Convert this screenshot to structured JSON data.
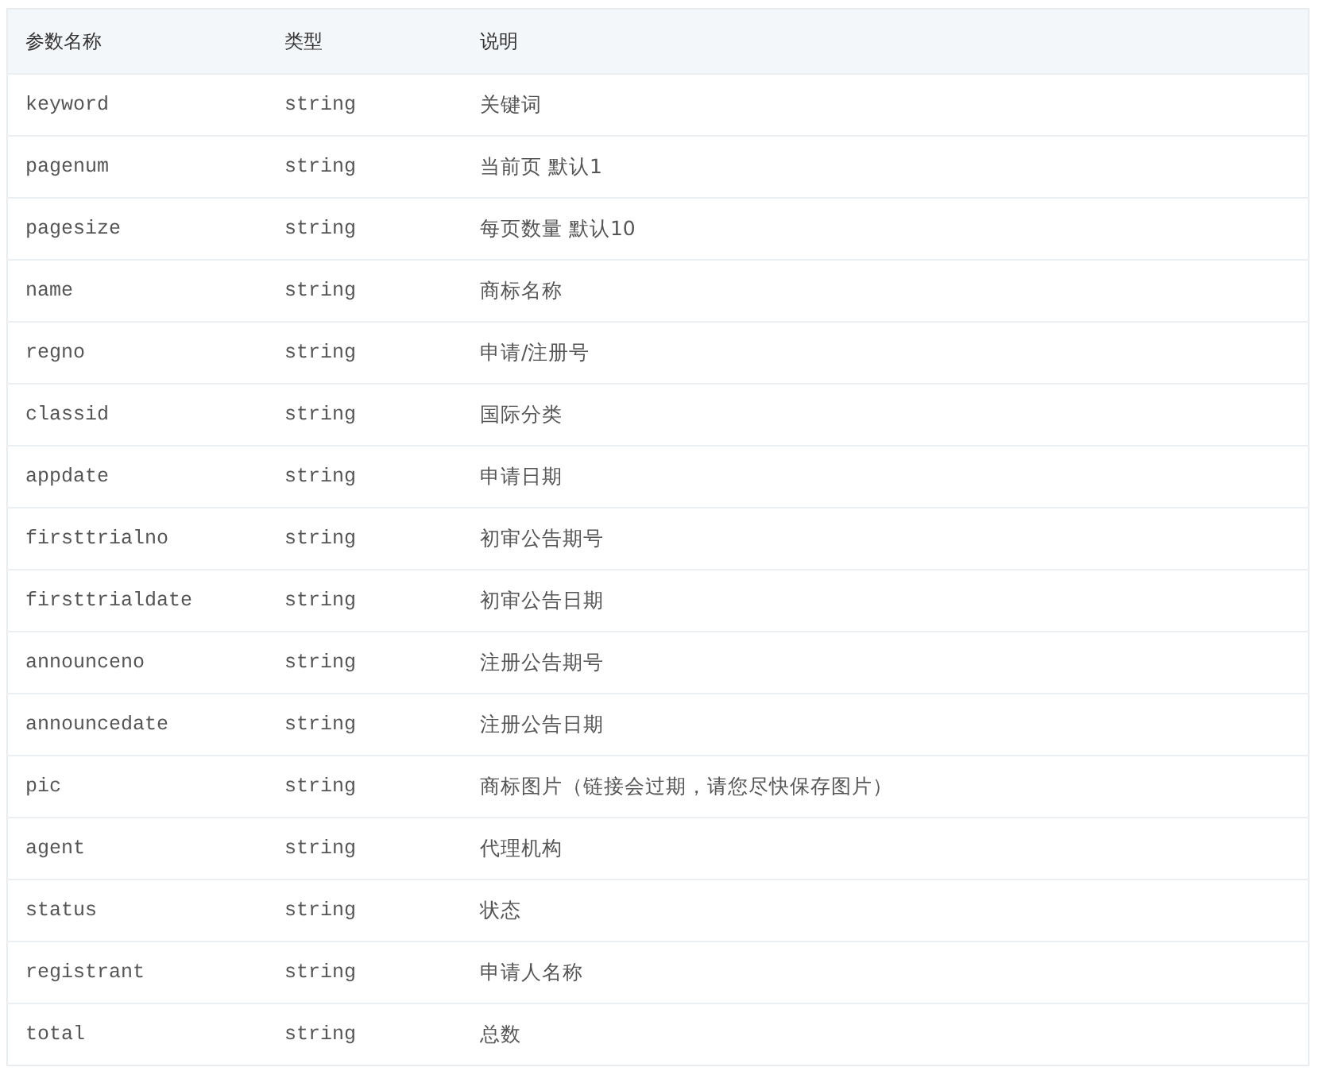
{
  "table": {
    "columns": [
      "参数名称",
      "类型",
      "说明"
    ],
    "rows": [
      {
        "name": "keyword",
        "type": "string",
        "description": "关键词"
      },
      {
        "name": "pagenum",
        "type": "string",
        "description": "当前页 默认1"
      },
      {
        "name": "pagesize",
        "type": "string",
        "description": "每页数量 默认10"
      },
      {
        "name": "name",
        "type": "string",
        "description": "商标名称"
      },
      {
        "name": "regno",
        "type": "string",
        "description": "申请/注册号"
      },
      {
        "name": "classid",
        "type": "string",
        "description": "国际分类"
      },
      {
        "name": "appdate",
        "type": "string",
        "description": "申请日期"
      },
      {
        "name": "firsttrialno",
        "type": "string",
        "description": "初审公告期号"
      },
      {
        "name": "firsttrialdate",
        "type": "string",
        "description": "初审公告日期"
      },
      {
        "name": "announceno",
        "type": "string",
        "description": "注册公告期号"
      },
      {
        "name": "announcedate",
        "type": "string",
        "description": "注册公告日期"
      },
      {
        "name": "pic",
        "type": "string",
        "description": "商标图片（链接会过期，请您尽快保存图片）"
      },
      {
        "name": "agent",
        "type": "string",
        "description": "代理机构"
      },
      {
        "name": "status",
        "type": "string",
        "description": "状态"
      },
      {
        "name": "registrant",
        "type": "string",
        "description": "申请人名称"
      },
      {
        "name": "total",
        "type": "string",
        "description": "总数"
      }
    ]
  }
}
